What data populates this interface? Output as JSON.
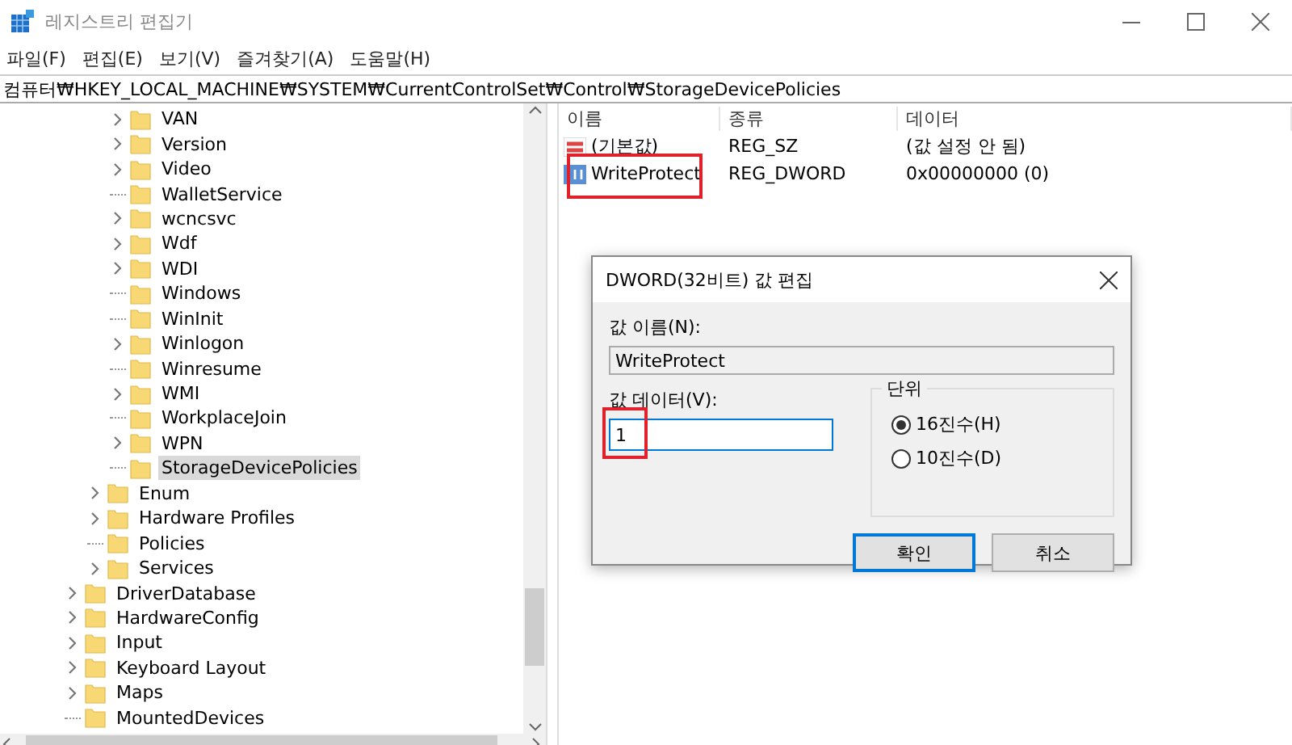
{
  "window": {
    "title": "레지스트리 편집기"
  },
  "menu": [
    "파일(F)",
    "편집(E)",
    "보기(V)",
    "즐겨찾기(A)",
    "도움말(H)"
  ],
  "address": "컴퓨터₩HKEY_LOCAL_MACHINE₩SYSTEM₩CurrentControlSet₩Control₩StorageDevicePolicies",
  "tree": [
    {
      "children": [
        {
          "children": [
            {
              "label": "VAN",
              "expandable": true,
              "selected": false
            },
            {
              "label": "Version",
              "expandable": true,
              "selected": false
            },
            {
              "label": "Video",
              "expandable": true,
              "selected": false
            },
            {
              "label": "WalletService",
              "expandable": false,
              "selected": false
            },
            {
              "label": "wcncsvc",
              "expandable": true,
              "selected": false
            },
            {
              "label": "Wdf",
              "expandable": true,
              "selected": false
            },
            {
              "label": "WDI",
              "expandable": true,
              "selected": false
            },
            {
              "label": "Windows",
              "expandable": false,
              "selected": false
            },
            {
              "label": "WinInit",
              "expandable": false,
              "selected": false
            },
            {
              "label": "Winlogon",
              "expandable": true,
              "selected": false
            },
            {
              "label": "Winresume",
              "expandable": false,
              "selected": false
            },
            {
              "label": "WMI",
              "expandable": true,
              "selected": false
            },
            {
              "label": "WorkplaceJoin",
              "expandable": false,
              "selected": false
            },
            {
              "label": "WPN",
              "expandable": true,
              "selected": false
            },
            {
              "label": "StorageDevicePolicies",
              "expandable": false,
              "selected": true
            }
          ]
        },
        {
          "label": "Enum",
          "expandable": true,
          "selected": false
        },
        {
          "label": "Hardware Profiles",
          "expandable": true,
          "selected": false
        },
        {
          "label": "Policies",
          "expandable": false,
          "selected": false
        },
        {
          "label": "Services",
          "expandable": true,
          "selected": false
        }
      ]
    },
    {
      "label": "DriverDatabase",
      "expandable": true,
      "selected": false
    },
    {
      "label": "HardwareConfig",
      "expandable": true,
      "selected": false
    },
    {
      "label": "Input",
      "expandable": true,
      "selected": false
    },
    {
      "label": "Keyboard Layout",
      "expandable": true,
      "selected": false
    },
    {
      "label": "Maps",
      "expandable": true,
      "selected": false
    },
    {
      "label": "MountedDevices",
      "expandable": false,
      "selected": false
    }
  ],
  "values": {
    "columns": [
      "이름",
      "종류",
      "데이터"
    ],
    "rows": [
      {
        "kind": "string",
        "name": "(기본값)",
        "type": "REG_SZ",
        "data": "(값 설정 안 됨)",
        "highlighted": false
      },
      {
        "kind": "binary",
        "name": "WriteProtect",
        "type": "REG_DWORD",
        "data": "0x00000000 (0)",
        "highlighted": true
      }
    ]
  },
  "dialog": {
    "title": "DWORD(32비트) 값 편집",
    "name_label": "값 이름(N):",
    "name_value": "WriteProtect",
    "data_label": "값 데이터(V):",
    "data_value": "1",
    "data_highlighted": true,
    "base_title": "단위",
    "bases": [
      {
        "label": "16진수(H)",
        "selected": true
      },
      {
        "label": "10진수(D)",
        "selected": false
      }
    ],
    "buttons": [
      {
        "label": "확인",
        "default": true
      },
      {
        "label": "취소",
        "default": false
      }
    ]
  }
}
